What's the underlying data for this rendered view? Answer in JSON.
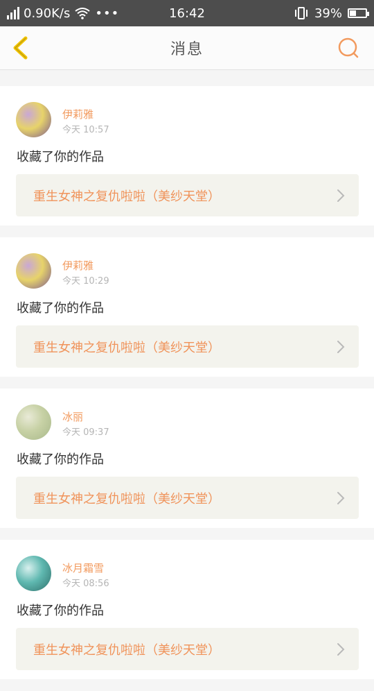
{
  "status_bar": {
    "net_speed": "0.90K/s",
    "more": "•••",
    "time": "16:42",
    "battery": "39%",
    "battery_level": 0.39
  },
  "header": {
    "title": "消息"
  },
  "messages": [
    {
      "user": "伊莉雅",
      "time": "今天 10:57",
      "action": "收藏了你的作品",
      "work": "重生女神之复仇啦啦（美纱天堂）",
      "avatar_colors": [
        "#c9a7d6",
        "#e7d36a",
        "#7c5a8f"
      ]
    },
    {
      "user": "伊莉雅",
      "time": "今天 10:29",
      "action": "收藏了你的作品",
      "work": "重生女神之复仇啦啦（美纱天堂）",
      "avatar_colors": [
        "#c9a7d6",
        "#e7d36a",
        "#7c5a8f"
      ]
    },
    {
      "user": "冰丽",
      "time": "今天 09:37",
      "action": "收藏了你的作品",
      "work": "重生女神之复仇啦啦（美纱天堂）",
      "avatar_colors": [
        "#e9ead7",
        "#c7d1a5",
        "#a8b88a"
      ]
    },
    {
      "user": "冰月霜雪",
      "time": "今天 08:56",
      "action": "收藏了你的作品",
      "work": "重生女神之复仇啦啦（美纱天堂）",
      "avatar_colors": [
        "#d8f0ee",
        "#5fb8b0",
        "#2f6f6a"
      ]
    }
  ],
  "colors": {
    "accent": "#f29a5e",
    "back_icon": "#f2c400",
    "search_icon": "#f29a5e"
  }
}
